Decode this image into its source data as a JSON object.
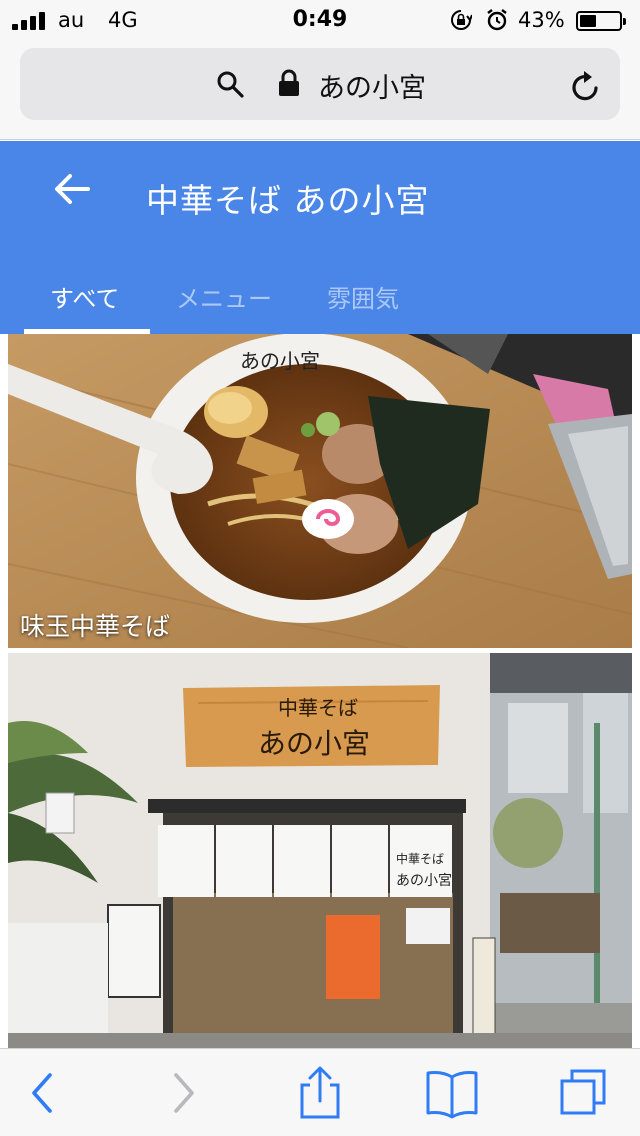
{
  "status_bar": {
    "carrier": "au",
    "network": "4G",
    "time": "0:49",
    "battery_percent": "43%",
    "battery_level": 0.43,
    "signal_bars": 4
  },
  "browser": {
    "url_text": "あの小宮"
  },
  "app": {
    "title": "中華そば あの小宮",
    "tabs": [
      {
        "label": "すべて",
        "active": true
      },
      {
        "label": "メニュー",
        "active": false
      },
      {
        "label": "雰囲気",
        "active": false
      }
    ]
  },
  "photos": [
    {
      "caption": "味玉中華そば"
    },
    {
      "caption": ""
    }
  ],
  "colors": {
    "header_blue": "#4a86e8",
    "ios_blue": "#2f7cf6",
    "bar_gray": "#f7f7f8"
  },
  "toolbar": {
    "icons": [
      "back-icon",
      "forward-icon",
      "share-icon",
      "bookmarks-icon",
      "tabs-icon"
    ]
  }
}
